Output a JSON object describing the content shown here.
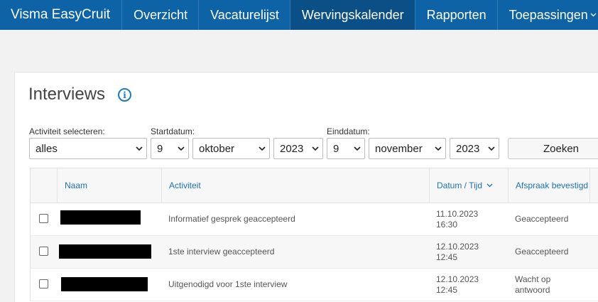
{
  "nav": {
    "brand": "Visma EasyCruit",
    "items": [
      "Overzicht",
      "Vacaturelijst",
      "Wervingskalender",
      "Rapporten",
      "Toepassingen"
    ],
    "active": "Wervingskalender"
  },
  "page": {
    "title": "Interviews"
  },
  "filters": {
    "activity_label": "Activiteit selecteren:",
    "activity_value": "alles",
    "start_label": "Startdatum:",
    "start_day": "9",
    "start_month": "oktober",
    "start_year": "2023",
    "end_label": "Einddatum:",
    "end_day": "9",
    "end_month": "november",
    "end_year": "2023",
    "search_button": "Zoeken"
  },
  "table": {
    "columns": [
      "Naam",
      "Activiteit",
      "Datum / Tijd",
      "Afspraak bevestigd"
    ],
    "sorted_column": "Datum / Tijd",
    "rows": [
      {
        "name": "",
        "activity": "Informatief gesprek geaccepteerd",
        "date": "11.10.2023",
        "time": "16:30",
        "confirmed": "Geaccepteerd"
      },
      {
        "name": "",
        "activity": "1ste interview geaccepteerd",
        "date": "12.10.2023",
        "time": "12:45",
        "confirmed": "Geaccepteerd"
      },
      {
        "name": "",
        "activity": "Uitgenodigd voor 1ste interview",
        "date": "12.10.2023",
        "time": "12:45",
        "confirmed": "Wacht op antwoord"
      }
    ]
  },
  "colors": {
    "nav_bg": "#0d63a5",
    "nav_active": "#0a4f86",
    "link": "#1a73b8"
  }
}
